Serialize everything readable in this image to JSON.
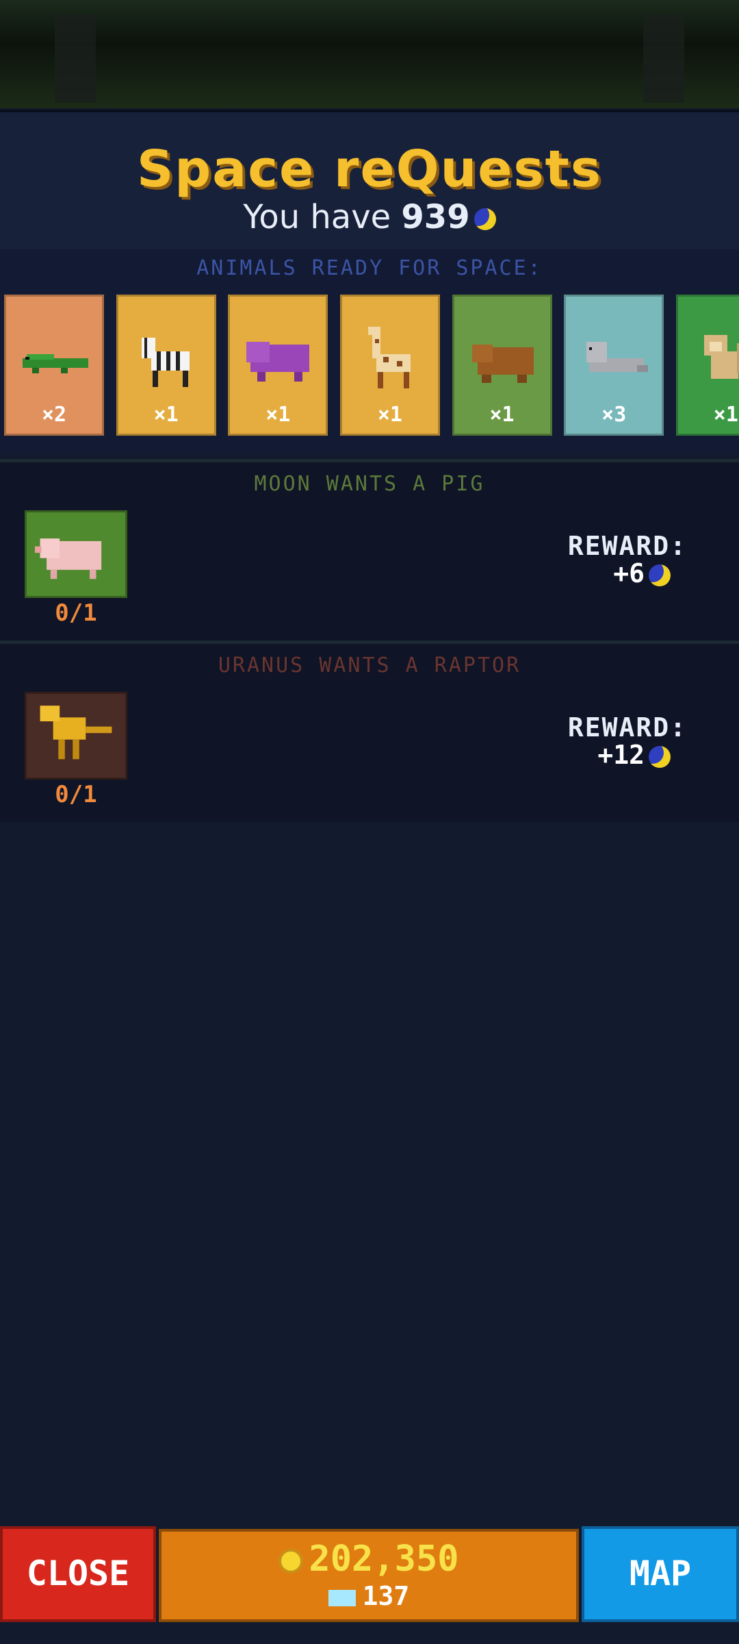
{
  "header": {
    "title": "Space reQuests",
    "you_have_prefix": "You have ",
    "you_have_amount": "939",
    "coin_icon": "moon-coin-icon"
  },
  "animals": {
    "label": "ANIMALS READY FOR SPACE:",
    "cards": [
      {
        "name": "crocodile",
        "count": "×2",
        "bg": "#e0915e"
      },
      {
        "name": "zebra",
        "count": "×1",
        "bg": "#e5ad40"
      },
      {
        "name": "hippo",
        "count": "×1",
        "bg": "#e5ad40"
      },
      {
        "name": "giraffe",
        "count": "×1",
        "bg": "#e5ad40"
      },
      {
        "name": "bear",
        "count": "×1",
        "bg": "#6a9a45"
      },
      {
        "name": "seal",
        "count": "×3",
        "bg": "#79b9bb"
      },
      {
        "name": "monkey",
        "count": "×1",
        "bg": "#3c9a45"
      }
    ]
  },
  "requests": [
    {
      "label": "MOON WANTS A PIG",
      "progress": "0/1",
      "reward_label": "REWARD:",
      "reward_value": "+6",
      "icon": "pig-icon",
      "icon_bg": "#4f8a2e"
    },
    {
      "label": "URANUS WANTS A RAPTOR",
      "progress": "0/1",
      "reward_label": "REWARD:",
      "reward_value": "+12",
      "icon": "raptor-icon",
      "icon_bg": "#4a2c26"
    }
  ],
  "bottom": {
    "close_label": "CLOSE",
    "gold": "202,350",
    "gems": "137",
    "map_label": "MAP"
  }
}
